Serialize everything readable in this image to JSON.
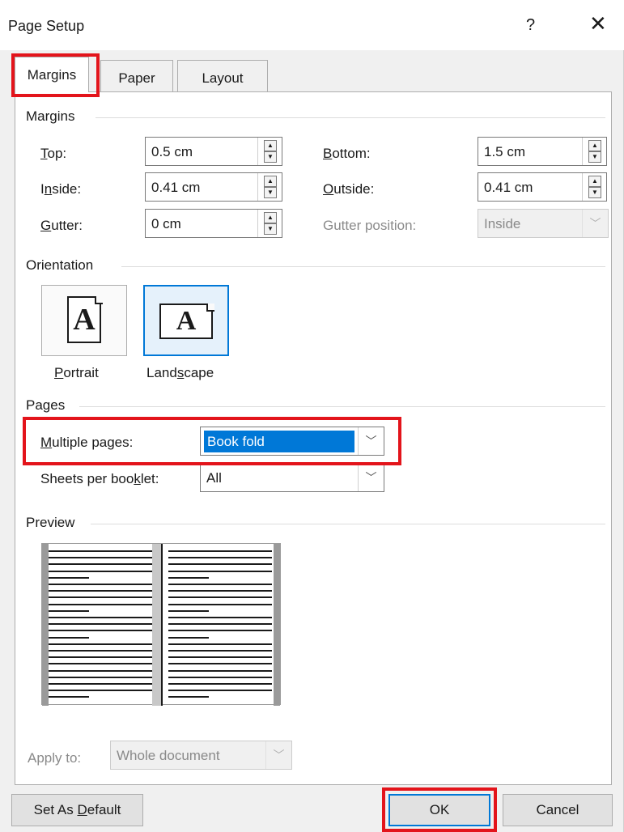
{
  "window": {
    "title": "Page Setup",
    "help_glyph": "?",
    "close_glyph": "✕"
  },
  "tabs": [
    {
      "label": "Margins",
      "active": true
    },
    {
      "label": "Paper",
      "active": false
    },
    {
      "label": "Layout",
      "active": false
    }
  ],
  "margins": {
    "group_label": "Margins",
    "top": {
      "label": "Top:",
      "value": "0.5 cm"
    },
    "bottom": {
      "label": "Bottom:",
      "value": "1.5 cm"
    },
    "inside": {
      "label": "Inside:",
      "value": "0.41 cm"
    },
    "outside": {
      "label": "Outside:",
      "value": "0.41 cm"
    },
    "gutter": {
      "label": "Gutter:",
      "value": "0 cm"
    },
    "gutter_position": {
      "label": "Gutter position:",
      "value": "Inside",
      "disabled": true
    }
  },
  "orientation": {
    "group_label": "Orientation",
    "portrait": {
      "label": "Portrait",
      "glyph": "A",
      "selected": false
    },
    "landscape": {
      "label": "Landscape",
      "glyph": "A",
      "selected": true
    }
  },
  "pages": {
    "group_label": "Pages",
    "multiple_pages": {
      "label": "Multiple pages:",
      "value": "Book fold"
    },
    "sheets_per_booklet": {
      "label": "Sheets per booklet:",
      "value": "All"
    }
  },
  "preview": {
    "group_label": "Preview"
  },
  "apply_to": {
    "label": "Apply to:",
    "value": "Whole document",
    "disabled": true
  },
  "buttons": {
    "set_default": "Set As Default",
    "ok": "OK",
    "cancel": "Cancel"
  },
  "colors": {
    "accent": "#0078d7",
    "highlight": "#e3141b"
  },
  "icons": {
    "spin_up": "▲",
    "spin_down": "▼",
    "dropdown": "﹀"
  }
}
